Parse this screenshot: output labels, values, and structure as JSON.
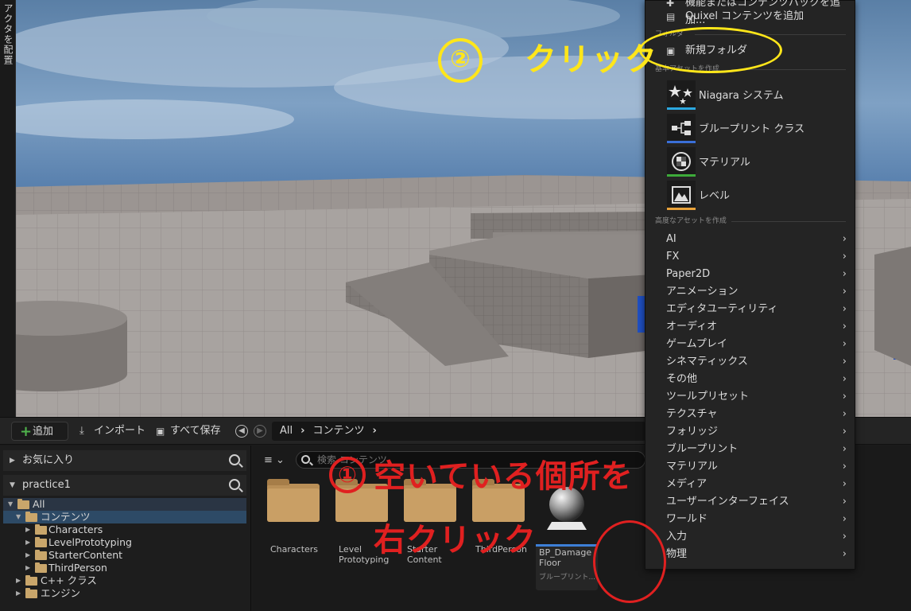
{
  "left_tab": {
    "label": "アクタを配置"
  },
  "toolbar": {
    "add_label": "追加",
    "import_label": "インポート",
    "saveall_label": "すべて保存"
  },
  "breadcrumb": {
    "items": [
      "All",
      "コンテンツ"
    ]
  },
  "left_panel": {
    "favorites_label": "お気に入り",
    "project_label": "practice1",
    "tree": {
      "all": "All",
      "content": "コンテンツ",
      "characters": "Characters",
      "level_prototyping": "LevelPrototyping",
      "starter_content": "StarterContent",
      "third_person": "ThirdPerson",
      "cpp_classes": "C++ クラス",
      "engine": "エンジン"
    }
  },
  "search": {
    "placeholder": "検索 コンテンツ"
  },
  "assets": {
    "folders": [
      {
        "name": "Characters"
      },
      {
        "name": "Level\nPrototyping"
      },
      {
        "name": "Starter\nContent"
      },
      {
        "name": "ThirdPerson"
      }
    ],
    "blueprint": {
      "name_line1": "BP_Damage",
      "name_line2": "Floor",
      "type": "ブループリント..."
    }
  },
  "context_menu": {
    "top_items": [
      "機能またはコンテンツパックを追加...",
      "Quixel コンテンツを追加"
    ],
    "folder_section": "フォルダ",
    "new_folder": "新規フォルダ",
    "basic_section": "基本アセットを作成",
    "basic_assets": [
      {
        "label": "Niagara システム",
        "stripe": "#2ba8e0"
      },
      {
        "label": "ブループリント クラス",
        "stripe": "#3a6fd8"
      },
      {
        "label": "マテリアル",
        "stripe": "#3dab3a"
      },
      {
        "label": "レベル",
        "stripe": "#e8a23a"
      }
    ],
    "advanced_section": "高度なアセットを作成",
    "advanced_items": [
      "AI",
      "FX",
      "Paper2D",
      "アニメーション",
      "エディタユーティリティ",
      "オーディオ",
      "ゲームプレイ",
      "シネマティックス",
      "その他",
      "ツールプリセット",
      "テクスチャ",
      "フォリッジ",
      "ブループリント",
      "マテリアル",
      "メディア",
      "ユーザーインターフェイス",
      "ワールド",
      "入力",
      "物理"
    ]
  },
  "annotations": {
    "step2_number": "②",
    "step2_text": "クリック",
    "step1_number": "①",
    "step1_line1": "空いている個所を",
    "step1_line2": "右クリック"
  },
  "colors": {
    "accent_blue": "#2d4a66",
    "annotation_yellow": "#ffe61a",
    "annotation_red": "#e02020",
    "folder": "#c9a66b"
  }
}
